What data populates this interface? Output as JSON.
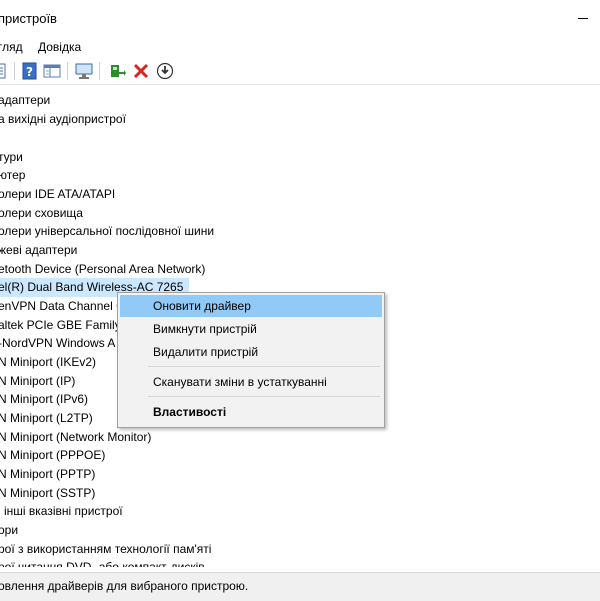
{
  "window": {
    "title": "пристроїв"
  },
  "menu": {
    "items": [
      "гляд",
      "Довідка"
    ]
  },
  "toolbar": {
    "buttons": [
      "properties-icon",
      "help-icon",
      "view-icon",
      "scan-hardware-icon",
      "update-driver-icon",
      "uninstall-icon",
      "download-icon"
    ]
  },
  "tree": {
    "rows": [
      "адаптери",
      "а вихідні аудіопристрої",
      "",
      "тури",
      "ютер",
      "олери IDE ATA/ATAPI",
      "олери сховища",
      "олери універсальної послідовної шини",
      "жеві адаптери",
      "etooth Device (Personal Area Network)",
      "el(R) Dual Band Wireless-AC 7265",
      "enVPN Data Channel C",
      "altek PCIe GBE Family C",
      "-NordVPN Windows A",
      "N Miniport (IKEv2)",
      "N Miniport (IP)",
      "N Miniport (IPv6)",
      "N Miniport (L2TP)",
      "N Miniport (Network Monitor)",
      "N Miniport (PPPOE)",
      "N Miniport (PPTP)",
      "N Miniport (SSTP)",
      "і інші вказівні пристрої",
      "ори",
      "рої з використанням технології пам'яті",
      "рої читання DVD- або компакт-дисків"
    ],
    "selected_index": 10
  },
  "context_menu": {
    "update_driver": "Оновити драйвер",
    "disable_device": "Вимкнути пристрій",
    "uninstall_device": "Видалити пристрій",
    "scan_changes": "Сканувати зміни в устаткуванні",
    "properties": "Властивості"
  },
  "status": {
    "text": "овлення драйверів для вибраного пристрою."
  },
  "colors": {
    "selection": "#cce8ff",
    "hover": "#91c9f7",
    "menu_bg": "#f2f2f2"
  }
}
